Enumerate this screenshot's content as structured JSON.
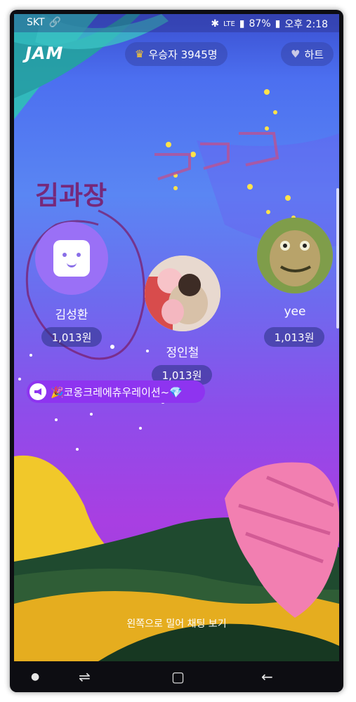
{
  "status_bar": {
    "carrier": "SKT",
    "battery": "87%",
    "time": "오후 2:18",
    "network": "LTE"
  },
  "header": {
    "logo": "JAM",
    "winners": "우승자 3945명",
    "heart": "하트"
  },
  "overlay": {
    "scribble_top": "ㅋㅋ",
    "scribble_name": "김과장"
  },
  "players": [
    {
      "name": "김성환",
      "prize": "1,013원",
      "avatar": "smile-face-icon"
    },
    {
      "name": "정인철",
      "prize": "1,013원",
      "avatar": "plush-photo"
    },
    {
      "name": "yee",
      "prize": "1,013원",
      "avatar": "lizard-photo"
    }
  ],
  "notice": {
    "text": "🎉코옹크레에츄우레이션~💎"
  },
  "footer": {
    "hint": "왼쪽으로 밀어 채팅 보기"
  },
  "colors": {
    "accent_purple": "#8e34f0",
    "crown": "#ffcc2f",
    "scribble": "#7a1f6e"
  }
}
